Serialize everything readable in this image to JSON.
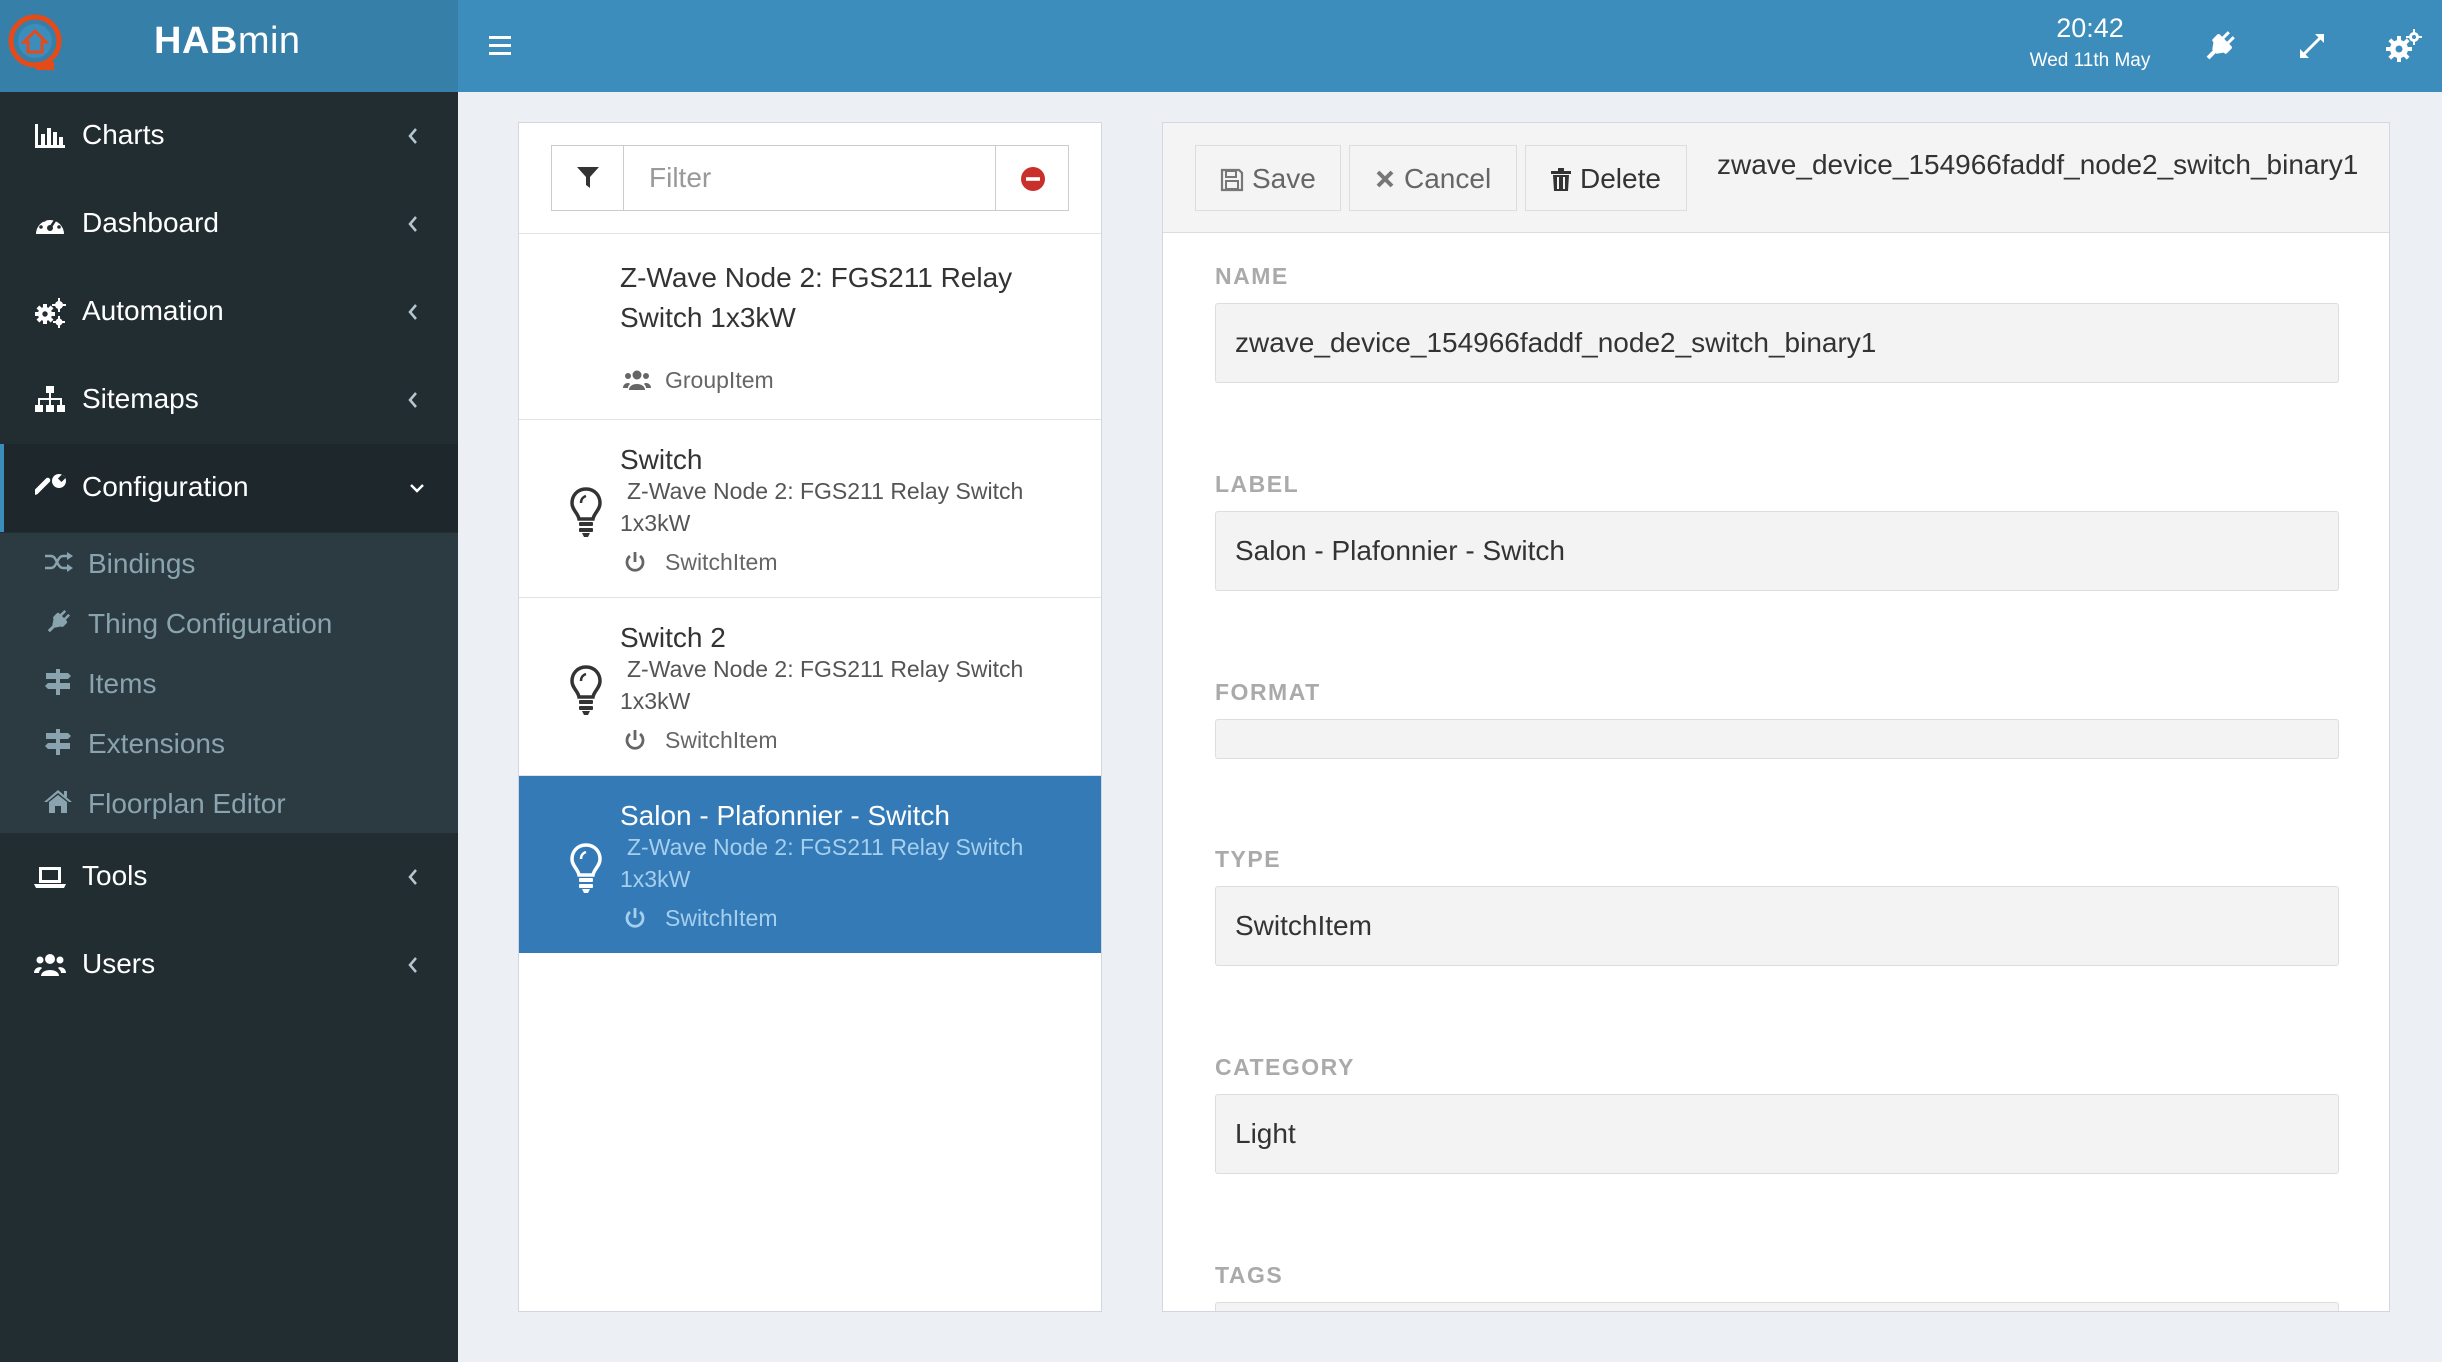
{
  "header": {
    "app_name_bold": "HAB",
    "app_name_light": "min",
    "time": "20:42",
    "date": "Wed 11th May"
  },
  "sidebar": {
    "items": [
      {
        "label": "Charts",
        "icon": "bar-chart-icon"
      },
      {
        "label": "Dashboard",
        "icon": "dashboard-icon"
      },
      {
        "label": "Automation",
        "icon": "cogs-icon"
      },
      {
        "label": "Sitemaps",
        "icon": "sitemap-icon"
      },
      {
        "label": "Configuration",
        "icon": "wrench-icon",
        "active": true
      },
      {
        "label": "Tools",
        "icon": "laptop-icon"
      },
      {
        "label": "Users",
        "icon": "users-icon"
      }
    ],
    "submenu": [
      {
        "label": "Bindings",
        "icon": "random-icon"
      },
      {
        "label": "Thing Configuration",
        "icon": "plug-icon"
      },
      {
        "label": "Items",
        "icon": "signpost-icon"
      },
      {
        "label": "Extensions",
        "icon": "signpost-icon"
      },
      {
        "label": "Floorplan Editor",
        "icon": "home-icon"
      }
    ]
  },
  "item_list": {
    "filter_placeholder": "Filter",
    "items": [
      {
        "title": "Z-Wave Node 2: FGS211 Relay Switch 1x3kW",
        "type": "GroupItem",
        "type_icon": "group-icon"
      },
      {
        "title": "Switch",
        "subtitle": "Z-Wave Node 2: FGS211 Relay Switch 1x3kW",
        "type": "SwitchItem",
        "icon": "lightbulb-icon"
      },
      {
        "title": "Switch 2",
        "subtitle": "Z-Wave Node 2: FGS211 Relay Switch 1x3kW",
        "type": "SwitchItem",
        "icon": "lightbulb-icon"
      },
      {
        "title": "Salon - Plafonnier - Switch",
        "subtitle": "Z-Wave Node 2: FGS211 Relay Switch 1x3kW",
        "type": "SwitchItem",
        "icon": "lightbulb-icon",
        "selected": true
      }
    ]
  },
  "details": {
    "save_label": "Save",
    "cancel_label": "Cancel",
    "delete_label": "Delete",
    "title": "zwave_device_154966faddf_node2_switch_binary1",
    "fields": {
      "name_label": "NAME",
      "name_value": "zwave_device_154966faddf_node2_switch_binary1",
      "label_label": "LABEL",
      "label_value": "Salon - Plafonnier - Switch",
      "format_label": "FORMAT",
      "format_value": "",
      "type_label": "TYPE",
      "type_value": "SwitchItem",
      "category_label": "CATEGORY",
      "category_value": "Light",
      "tags_label": "TAGS"
    }
  },
  "colors": {
    "header": "#3c8dbc",
    "logo_area": "#367fa9",
    "sidebar": "#222d32",
    "submenu": "#2c3b41",
    "selected_item": "#337ab7",
    "accent_remove": "#c9302c"
  }
}
